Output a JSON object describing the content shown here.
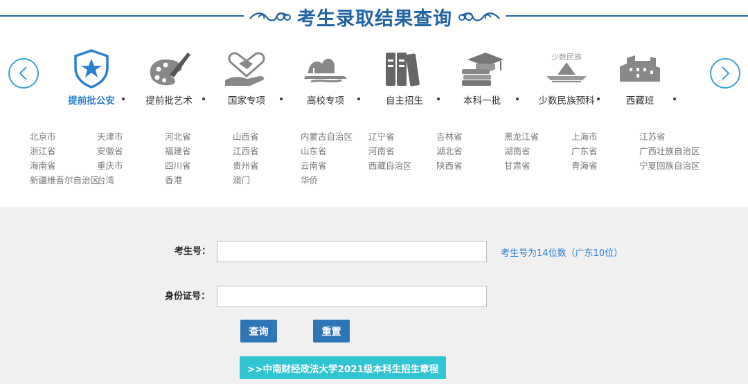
{
  "header": {
    "title": "考生录取结果查询"
  },
  "carousel": {
    "prev_icon": "chevron-left-icon",
    "next_icon": "chevron-right-icon",
    "accent_color": "#3aa1d8",
    "categories": [
      {
        "label": "提前批公安",
        "icon": "police-shield-icon",
        "active": true
      },
      {
        "label": "提前批艺术",
        "icon": "paint-palette-icon",
        "active": false
      },
      {
        "label": "国家专项",
        "icon": "handshake-icon",
        "active": false
      },
      {
        "label": "高校专项",
        "icon": "landscape-icon",
        "active": false
      },
      {
        "label": "自主招生",
        "icon": "books-icon",
        "active": false
      },
      {
        "label": "本科一批",
        "icon": "graduation-cap-icon",
        "active": false
      },
      {
        "label": "少数民族预科",
        "icon": "ethnic-hat-icon",
        "icon_text": "少数民族",
        "active": false
      },
      {
        "label": "西藏班",
        "icon": "potala-palace-icon",
        "active": false
      }
    ]
  },
  "provinces": [
    "北京市",
    "天津市",
    "河北省",
    "山西省",
    "内蒙古自治区",
    "辽宁省",
    "吉林省",
    "黑龙江省",
    "上海市",
    "江苏省",
    "浙江省",
    "安徽省",
    "福建省",
    "江西省",
    "山东省",
    "河南省",
    "湖北省",
    "湖南省",
    "广东省",
    "广西壮族自治区",
    "海南省",
    "重庆市",
    "四川省",
    "贵州省",
    "云南省",
    "西藏自治区",
    "陕西省",
    "甘肃省",
    "青海省",
    "宁夏回族自治区",
    "新疆维吾尔自治区",
    "台湾",
    "香港",
    "澳门",
    "华侨"
  ],
  "form": {
    "exam_no_label": "考生号：",
    "exam_no_value": "",
    "exam_no_hint": "考生号为14位数（广东10位）",
    "id_no_label": "身份证号：",
    "id_no_value": "",
    "query_label": "查询",
    "reset_label": "重置",
    "rules_link": ">>中南财经政法大学2021级本科生招生章程",
    "button_color": "#2e76b6",
    "link_color": "#31c4d2"
  }
}
